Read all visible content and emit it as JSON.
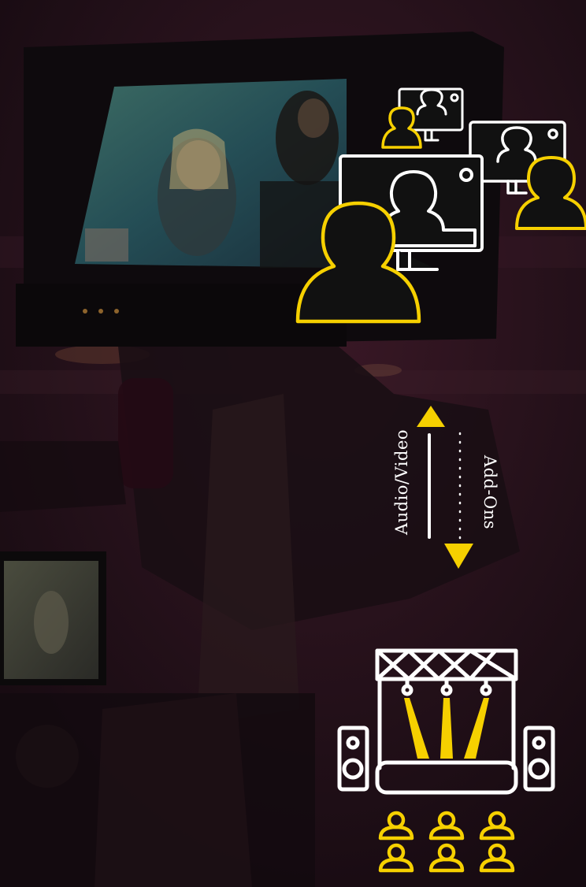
{
  "labels": {
    "audio_video": "Audio/Video",
    "add_ons": "Add-Ons"
  },
  "colors": {
    "accent_yellow": "#f6d000",
    "line_white": "#ffffff",
    "icon_fill": "#111111",
    "background": "#1c0f17"
  },
  "icons": [
    "camera-monitor-photo",
    "video-call-group-icon",
    "bidirectional-arrow-icon",
    "stage-with-speakers-icon",
    "audience-icon"
  ]
}
